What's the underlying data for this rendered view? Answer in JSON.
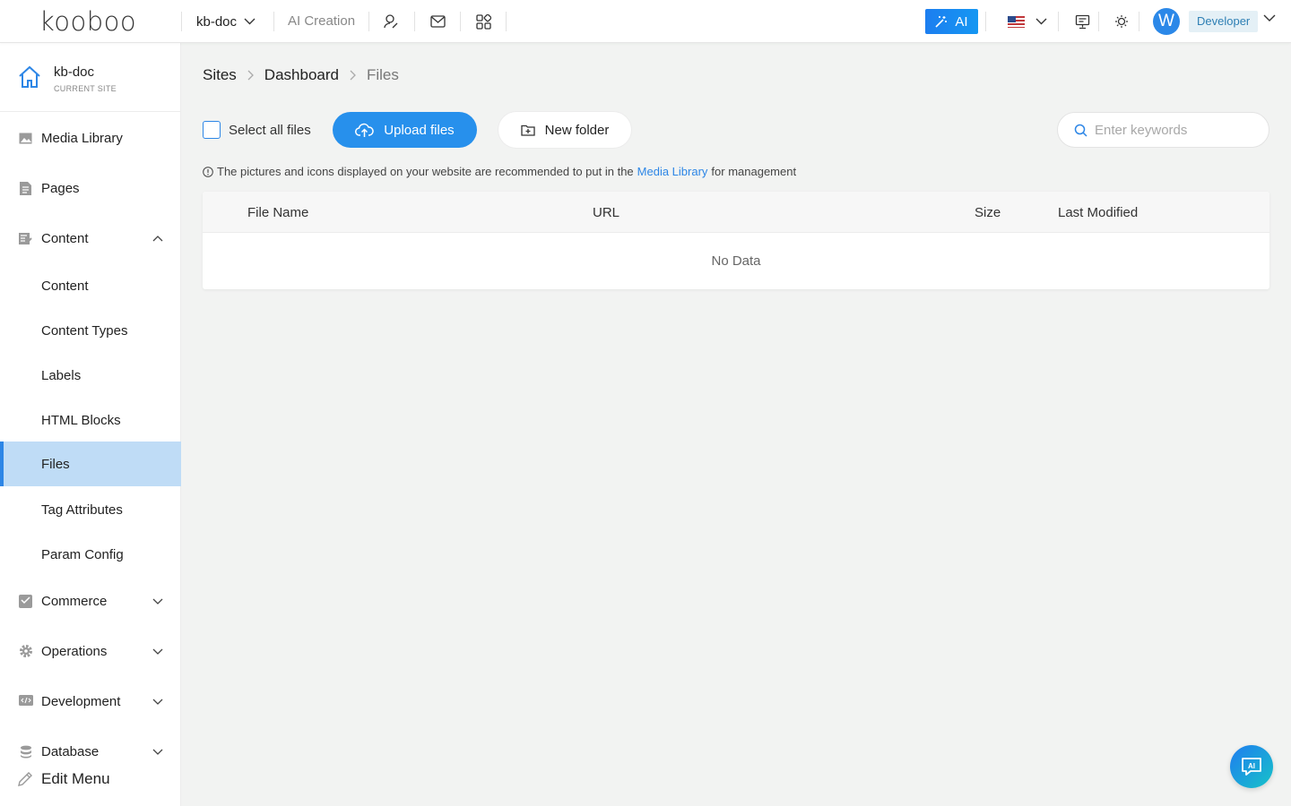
{
  "topbar": {
    "logo": "kooboo",
    "site_switch": "kb-doc",
    "ai_creation": "AI Creation",
    "ai_button": "AI",
    "avatar_letter": "W",
    "role": "Developer"
  },
  "sidebar": {
    "site_name": "kb-doc",
    "site_sub": "CURRENT SITE",
    "items": [
      {
        "label": "Media Library",
        "icon": "image-icon"
      },
      {
        "label": "Pages",
        "icon": "page-icon"
      },
      {
        "label": "Content",
        "icon": "content-icon"
      },
      {
        "label": "Content"
      },
      {
        "label": "Content Types"
      },
      {
        "label": "Labels"
      },
      {
        "label": "HTML Blocks"
      },
      {
        "label": "Files"
      },
      {
        "label": "Tag Attributes"
      },
      {
        "label": "Param Config"
      },
      {
        "label": "Commerce",
        "icon": "commerce-icon"
      },
      {
        "label": "Operations",
        "icon": "gear-icon"
      },
      {
        "label": "Development",
        "icon": "code-icon"
      },
      {
        "label": "Database",
        "icon": "database-icon"
      }
    ],
    "edit_menu": "Edit Menu"
  },
  "breadcrumb": [
    "Sites",
    "Dashboard",
    "Files"
  ],
  "toolbar": {
    "select_all": "Select all files",
    "upload": "Upload files",
    "new_folder": "New folder",
    "search_placeholder": "Enter keywords"
  },
  "tip": {
    "prefix": "The pictures and icons displayed on your website are recommended to put in the",
    "link": "Media Library",
    "suffix": "for management"
  },
  "table": {
    "columns": [
      "File Name",
      "URL",
      "Size",
      "Last Modified"
    ],
    "empty": "No Data"
  },
  "colors": {
    "accent": "#2790ec",
    "active_bg": "#bfdcf6",
    "role_bg": "#e4f0f6"
  }
}
